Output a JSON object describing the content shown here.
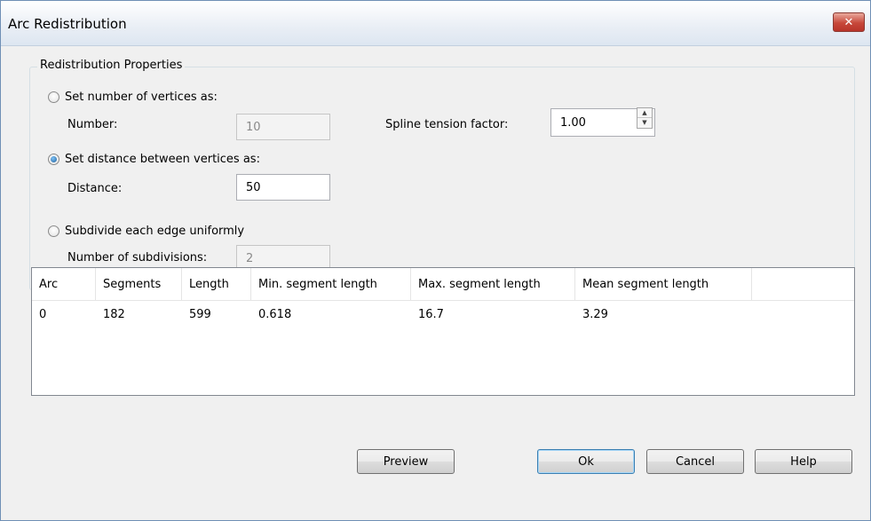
{
  "window": {
    "title": "Arc Redistribution",
    "close_label": "✕"
  },
  "group": {
    "legend": "Redistribution Properties"
  },
  "options": {
    "set_vertices": {
      "label": "Set number of vertices as:",
      "field_label": "Number:",
      "value": "10"
    },
    "spline": {
      "label": "Spline tension factor:",
      "value": "1.00"
    },
    "set_distance": {
      "label": "Set distance between vertices as:",
      "field_label": "Distance:",
      "value": "50"
    },
    "subdivide": {
      "label": "Subdivide each edge uniformly",
      "field_label": "Number of subdivisions:",
      "value": "2"
    }
  },
  "table": {
    "columns": [
      "Arc",
      "Segments",
      "Length",
      "Min. segment length",
      "Max. segment length",
      "Mean segment length"
    ],
    "rows": [
      [
        "0",
        "182",
        "599",
        "0.618",
        "16.7",
        "3.29"
      ]
    ]
  },
  "buttons": {
    "preview": "Preview",
    "ok": "Ok",
    "cancel": "Cancel",
    "help": "Help"
  }
}
